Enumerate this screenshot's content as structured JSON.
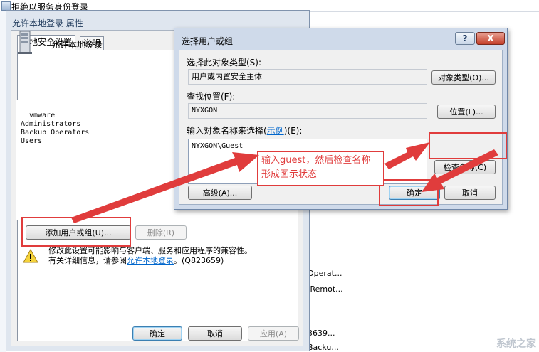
{
  "background_window": {
    "title": "拒绝以服务身份登录",
    "right_items": [
      "Operat...",
      ",Remot...",
      "3639...",
      "Backu..."
    ]
  },
  "properties_dialog": {
    "title": "允许本地登录 属性",
    "tabs": [
      "本地安全设置",
      "说明"
    ],
    "policy_name": "允许本地登录",
    "users": [
      "__vmware__",
      "Administrators",
      "Backup Operators",
      "Users"
    ],
    "add_button": "添加用户或组(U)...",
    "remove_button": "删除(R)",
    "warning_line1": "修改此设置可能影响与客户端、服务和应用程序的兼容性。",
    "warning_line2_prefix": "有关详细信息，请参阅",
    "warning_link": "允许本地登录",
    "warning_suffix": "。(Q823659)",
    "ok": "确定",
    "cancel": "取消",
    "apply": "应用(A)"
  },
  "select_dialog": {
    "title": "选择用户或组",
    "help_label": "?",
    "close_label": "X",
    "object_type_label": "选择此对象类型(S):",
    "object_type_value": "用户或内置安全主体",
    "object_type_button": "对象类型(O)...",
    "location_label": "查找位置(F):",
    "location_value": "NYXGON",
    "location_button": "位置(L)...",
    "names_label_prefix": "输入对象名称来选择(",
    "names_label_link": "示例",
    "names_label_suffix": ")(E):",
    "names_value": "NYXGON\\Guest",
    "check_names_button": "检查名称(C)",
    "advanced_button": "高级(A)...",
    "ok": "确定",
    "cancel": "取消"
  },
  "annotation": {
    "line1": "输入guest，然后检查名称",
    "line2": "形成图示状态"
  },
  "colors": {
    "annotation_red": "#e03c3c",
    "link_blue": "#0066cc"
  },
  "watermark": "系统之家"
}
